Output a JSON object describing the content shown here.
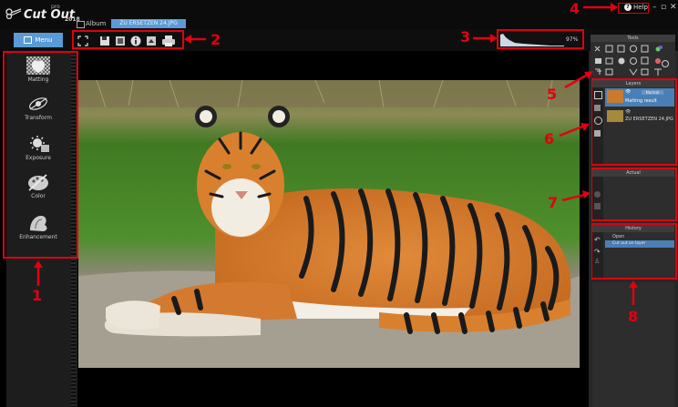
{
  "app": {
    "logo_text": "Cut Out",
    "logo_edition": "pro",
    "logo_year": "2018"
  },
  "tabs": {
    "album_label": "Album",
    "file_label": "ZU ERSETZEN 24.JPG"
  },
  "window": {
    "help_label": "Help",
    "help_icon": "help-icon",
    "minimize": "–",
    "restore": "▫",
    "close": "✕"
  },
  "left_menu": {
    "menu_label": "Menu",
    "items": [
      {
        "label": "Matting",
        "icon": "matting-icon"
      },
      {
        "label": "Transform",
        "icon": "transform-icon"
      },
      {
        "label": "Exposure",
        "icon": "exposure-icon"
      },
      {
        "label": "Color",
        "icon": "color-icon"
      },
      {
        "label": "Enhancement",
        "icon": "enhancement-icon"
      }
    ]
  },
  "toolbar": {
    "buttons": [
      "fit-screen-icon",
      "save-icon",
      "export-icon",
      "info-icon",
      "crop-icon",
      "print-icon"
    ]
  },
  "histogram": {
    "zoom_value": "97%"
  },
  "panels": {
    "tools_title": "Tools",
    "layers_title": "Layers",
    "layer_items": [
      {
        "name": "Matting result",
        "mode": "Normal"
      },
      {
        "name": "ZU ERSETZEN 24.JPG"
      }
    ],
    "action_title": "Actual",
    "history_title": "History",
    "history_items": [
      "Open",
      "Cut out on layer"
    ]
  },
  "annotations": [
    "1",
    "2",
    "3",
    "4",
    "5",
    "6",
    "7",
    "8"
  ],
  "colors": {
    "accent": "#5b9bd5",
    "annotation_red": "#e00010"
  }
}
